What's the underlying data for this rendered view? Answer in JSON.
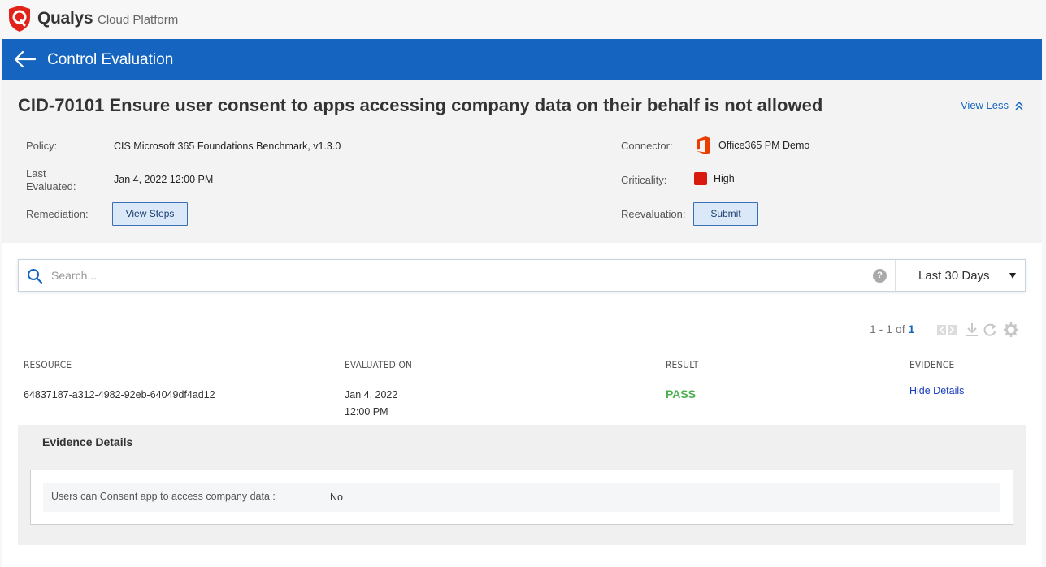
{
  "brand": {
    "name": "Qualys",
    "subtitle": "Cloud Platform"
  },
  "header": {
    "title": "Control Evaluation"
  },
  "control": {
    "title": "CID-70101 Ensure user consent to apps accessing company data on their behalf is not allowed",
    "view_less_label": "View Less",
    "policy_label": "Policy:",
    "policy_value": "CIS Microsoft 365 Foundations Benchmark, v1.3.0",
    "last_evaluated_label_1": "Last",
    "last_evaluated_label_2": "Evaluated:",
    "last_evaluated_value": "Jan 4, 2022 12:00 PM",
    "remediation_label": "Remediation:",
    "view_steps_label": "View Steps",
    "connector_label": "Connector:",
    "connector_value": "Office365 PM Demo",
    "criticality_label": "Criticality:",
    "criticality_value": "High",
    "criticality_color": "#d91a0e",
    "reevaluation_label": "Reevaluation:",
    "submit_label": "Submit"
  },
  "search": {
    "placeholder": "Search...",
    "help": "?",
    "range": "Last 30 Days"
  },
  "pager": {
    "range": "1 - 1 of",
    "total": "1"
  },
  "table": {
    "columns": [
      "RESOURCE",
      "EVALUATED ON",
      "RESULT",
      "EVIDENCE"
    ],
    "rows": [
      {
        "resource": "64837187-a312-4982-92eb-64049df4ad12",
        "date": "Jan 4, 2022",
        "time": "12:00 PM",
        "result": "PASS",
        "evidence_action": "Hide Details"
      }
    ]
  },
  "evidence": {
    "title": "Evidence Details",
    "items": [
      {
        "label": "Users can Consent app to access company data :",
        "value": "No"
      }
    ]
  },
  "colors": {
    "header_blue": "#1565c0",
    "pass_green": "#4caf50",
    "brand_red": "#e2231a"
  }
}
